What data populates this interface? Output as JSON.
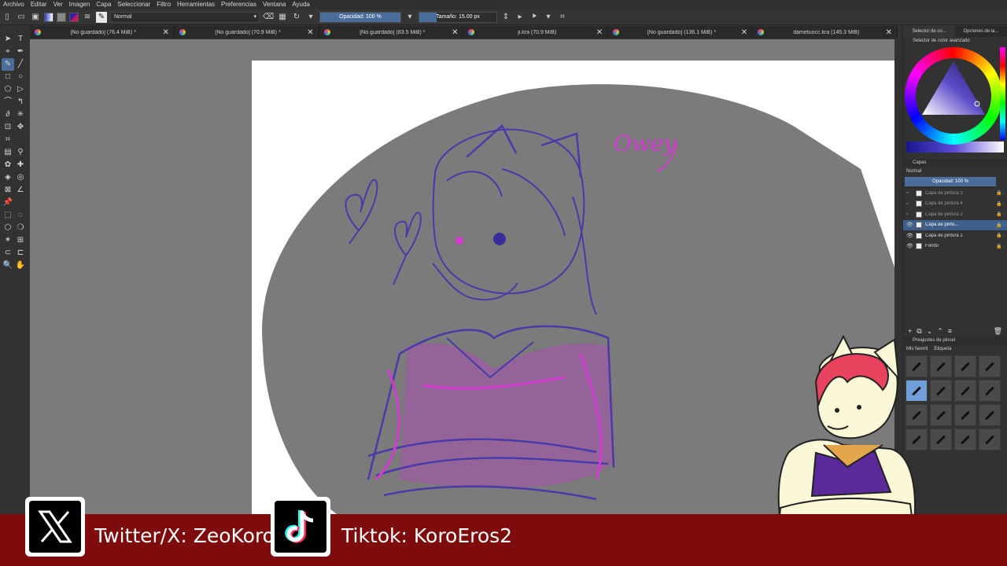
{
  "menubar": [
    "Archivo",
    "Editar",
    "Ver",
    "Imagen",
    "Capa",
    "Seleccionar",
    "Filtro",
    "Herramientas",
    "Preferencias",
    "Ventana",
    "Ayuda"
  ],
  "toolbar": {
    "blend_mode": "Normal",
    "opacity_label": "Opacidad: 100 %",
    "opacity_value": 1.0,
    "size_label": "Tamaño: 15.00 px",
    "size_value": 0.15
  },
  "tabs": [
    {
      "label": "[No guardado]  (76.4 MiB) *"
    },
    {
      "label": "[No guardado]  (70.9 MiB) *"
    },
    {
      "label": "[No guardado]  (83.5 MiB) *"
    },
    {
      "label": "ji.kra (70.9 MiB)"
    },
    {
      "label": "[No guardado]  (136.1 MiB) *"
    },
    {
      "label": "dametuocc.kra (145.3 MiB)"
    }
  ],
  "canvas": {
    "annotation": "Owey"
  },
  "color_panel": {
    "tabs": [
      "Selector de co...",
      "Opciones de la..."
    ],
    "title": "Selector de color avanzado"
  },
  "layers_panel": {
    "title": "Capas",
    "blend_mode": "Normal",
    "opacity_label": "Opacidad:  100 %",
    "layers": [
      {
        "name": "Capa de pintura 3",
        "visible": false,
        "selected": false
      },
      {
        "name": "Capa de pintura 4",
        "visible": false,
        "selected": false
      },
      {
        "name": "Capa de pintura 2",
        "visible": false,
        "selected": false
      },
      {
        "name": "Capa de pintu...",
        "visible": true,
        "selected": true
      },
      {
        "name": "Capa de pintura 1",
        "visible": true,
        "selected": false
      },
      {
        "name": "Fondo",
        "visible": true,
        "selected": false
      }
    ]
  },
  "brush_panel": {
    "title": "Preajustes de pincel",
    "filter": "Mis favorit",
    "tag_label": "Etiqueta"
  },
  "social": {
    "twitter": "Twitter/X: ZeoKoro",
    "tiktok": "Tiktok: KoroEros2"
  },
  "colors": {
    "accent": "#4a6d99",
    "banner": "#7e0c0c",
    "sketch_blue": "#4a3aa8",
    "sketch_pink": "#d23ad0",
    "bubble_grey": "#7b7b7b"
  }
}
